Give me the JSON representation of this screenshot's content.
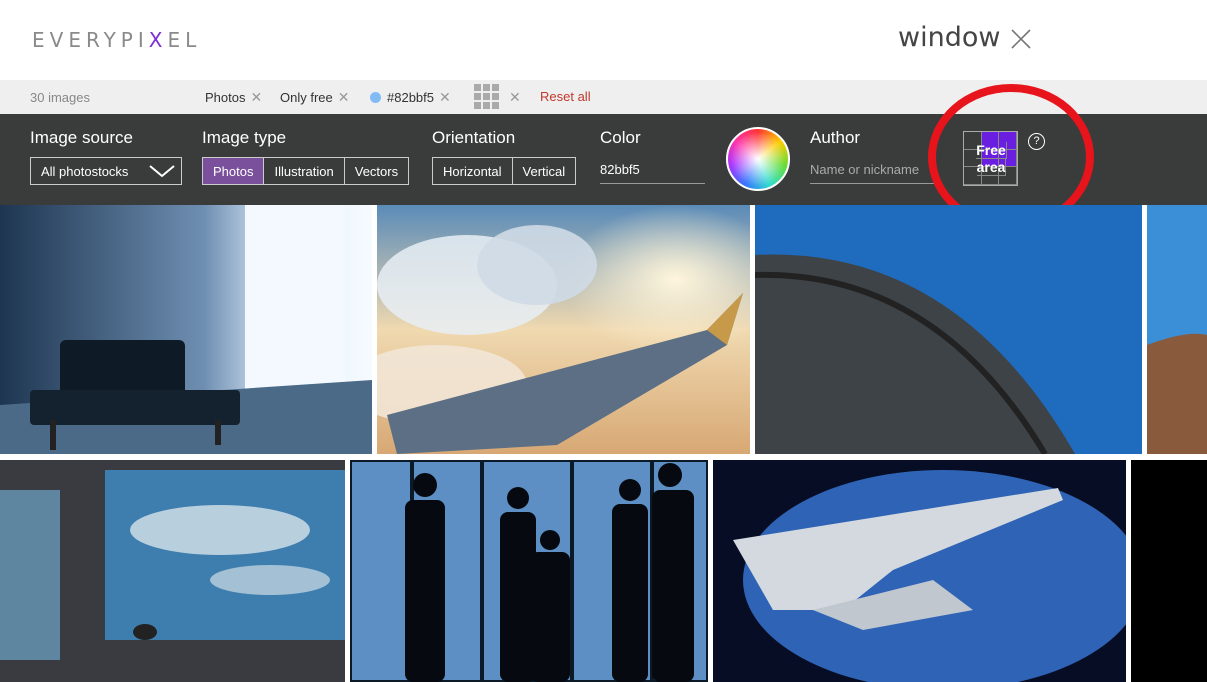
{
  "header": {
    "logo_pre": "EVERYPI",
    "logo_x": "X",
    "logo_post": "EL",
    "search_query": "window"
  },
  "filterbar": {
    "count": "30 images",
    "chips": [
      "Photos",
      "Only free",
      "#82bbf5"
    ],
    "reset": "Reset all"
  },
  "panel": {
    "image_source": {
      "title": "Image source",
      "value": "All photostocks"
    },
    "image_type": {
      "title": "Image type",
      "options": [
        "Photos",
        "Illustration",
        "Vectors"
      ],
      "selected": "Photos"
    },
    "orientation": {
      "title": "Orientation",
      "options": [
        "Horizontal",
        "Vertical"
      ]
    },
    "color": {
      "title": "Color",
      "value": "82bbf5",
      "swatch": "#82bbf5"
    },
    "author": {
      "title": "Author",
      "placeholder": "Name or nickname"
    },
    "free_area": {
      "label_line1": "Free",
      "label_line2": "area",
      "selected_color": "#6a1fe0"
    },
    "help": "?"
  },
  "accent": {
    "purple": "#7a4f9c",
    "reset_red": "#c0392b",
    "annotation_red": "#e8141b"
  },
  "photos": [
    {
      "subject": "leather bench by bright window"
    },
    {
      "subject": "airplane wing above sunset clouds"
    },
    {
      "subject": "aircraft window frame with blue sky"
    },
    {
      "subject": "tiled rooftop against sky"
    },
    {
      "subject": "bird silhouette at window with clouds"
    },
    {
      "subject": "business people silhouettes at office window"
    },
    {
      "subject": "airplane wing over blue earth"
    },
    {
      "subject": "dark image"
    }
  ]
}
